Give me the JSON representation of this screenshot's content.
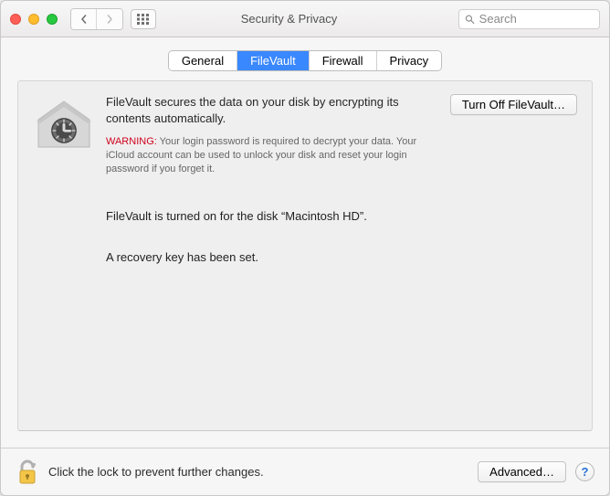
{
  "window_title": "Security & Privacy",
  "search": {
    "placeholder": "Search"
  },
  "tabs": {
    "general": "General",
    "filevault": "FileVault",
    "firewall": "Firewall",
    "privacy": "Privacy",
    "active": "filevault"
  },
  "filevault": {
    "intro": "FileVault secures the data on your disk by encrypting its contents automatically.",
    "turn_off_label": "Turn Off FileVault…",
    "warning_label": "WARNING:",
    "warning_body": "Your login password is required to decrypt your data. Your iCloud account can be used to unlock your disk and reset your login password if you forget it.",
    "status": "FileVault is turned on for the disk “Macintosh HD”.",
    "recovery": "A recovery key has been set."
  },
  "footer": {
    "lock_text": "Click the lock to prevent further changes.",
    "advanced_label": "Advanced…"
  }
}
